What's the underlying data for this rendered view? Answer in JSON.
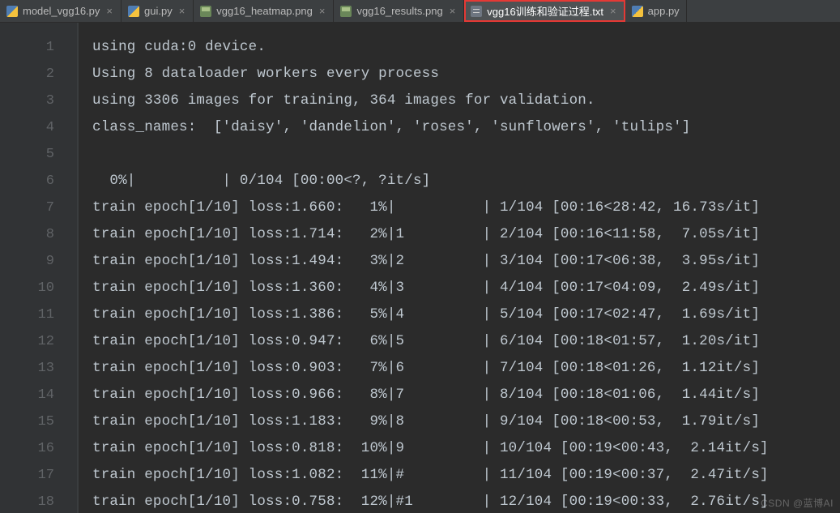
{
  "tabs": [
    {
      "label": "model_vgg16.py",
      "icon": "python-file-icon",
      "active": false
    },
    {
      "label": "gui.py",
      "icon": "python-file-icon",
      "active": false
    },
    {
      "label": "vgg16_heatmap.png",
      "icon": "image-file-icon",
      "active": false
    },
    {
      "label": "vgg16_results.png",
      "icon": "image-file-icon",
      "active": false
    },
    {
      "label": "vgg16训练和验证过程.txt",
      "icon": "text-file-icon",
      "active": true
    },
    {
      "label": "app.py",
      "icon": "python-file-icon",
      "active": false
    }
  ],
  "close_glyph": "×",
  "line_numbers": [
    "1",
    "2",
    "3",
    "4",
    "5",
    "6",
    "7",
    "8",
    "9",
    "10",
    "11",
    "12",
    "13",
    "14",
    "15",
    "16",
    "17",
    "18"
  ],
  "lines": [
    "using cuda:0 device.",
    "Using 8 dataloader workers every process",
    "using 3306 images for training, 364 images for validation.",
    "class_names:  ['daisy', 'dandelion', 'roses', 'sunflowers', 'tulips']",
    "",
    "  0%|          | 0/104 [00:00<?, ?it/s]",
    "train epoch[1/10] loss:1.660:   1%|          | 1/104 [00:16<28:42, 16.73s/it]",
    "train epoch[1/10] loss:1.714:   2%|1         | 2/104 [00:16<11:58,  7.05s/it]",
    "train epoch[1/10] loss:1.494:   3%|2         | 3/104 [00:17<06:38,  3.95s/it]",
    "train epoch[1/10] loss:1.360:   4%|3         | 4/104 [00:17<04:09,  2.49s/it]",
    "train epoch[1/10] loss:1.386:   5%|4         | 5/104 [00:17<02:47,  1.69s/it]",
    "train epoch[1/10] loss:0.947:   6%|5         | 6/104 [00:18<01:57,  1.20s/it]",
    "train epoch[1/10] loss:0.903:   7%|6         | 7/104 [00:18<01:26,  1.12it/s]",
    "train epoch[1/10] loss:0.966:   8%|7         | 8/104 [00:18<01:06,  1.44it/s]",
    "train epoch[1/10] loss:1.183:   9%|8         | 9/104 [00:18<00:53,  1.79it/s]",
    "train epoch[1/10] loss:0.818:  10%|9         | 10/104 [00:19<00:43,  2.14it/s]",
    "train epoch[1/10] loss:1.082:  11%|#         | 11/104 [00:19<00:37,  2.47it/s]",
    "train epoch[1/10] loss:0.758:  12%|#1        | 12/104 [00:19<00:33,  2.76it/s]"
  ],
  "watermark": "CSDN @蓝博AI"
}
